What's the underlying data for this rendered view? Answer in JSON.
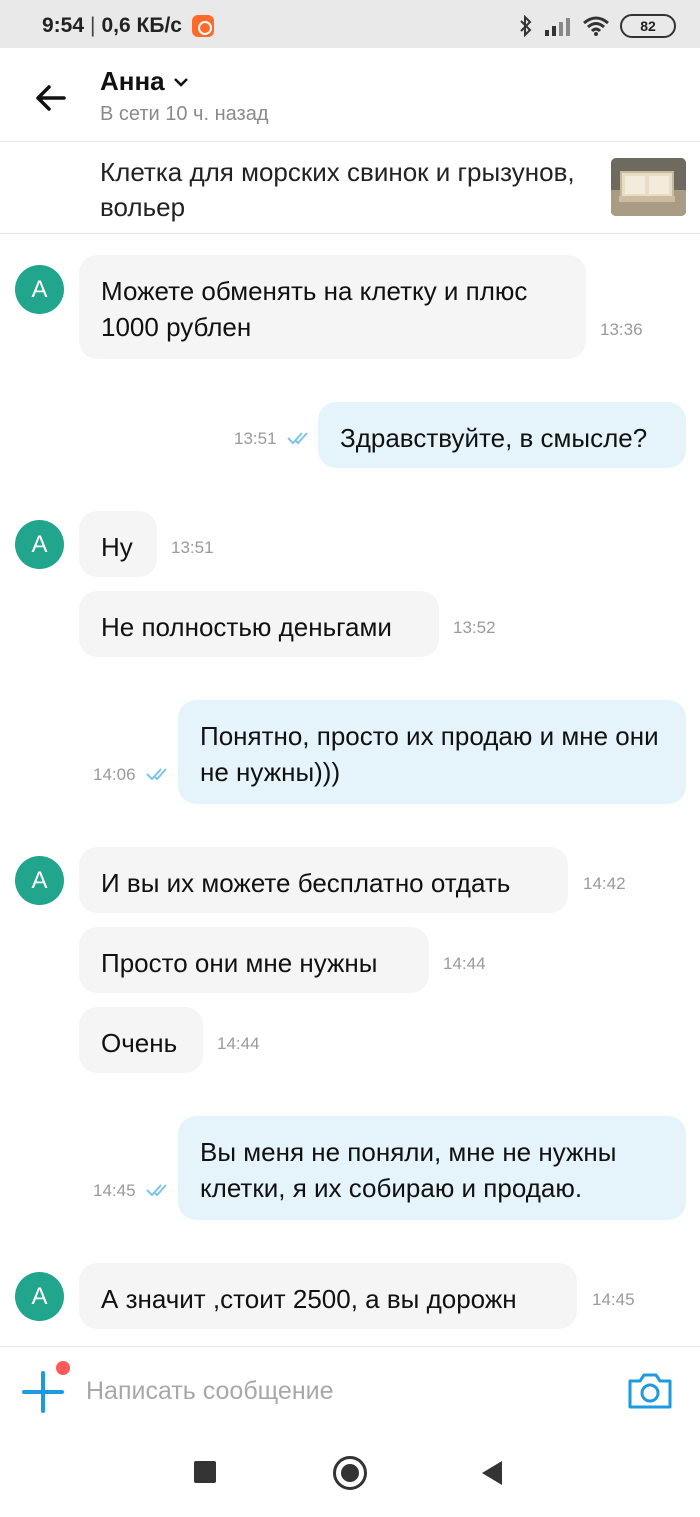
{
  "status_bar": {
    "time": "9:54",
    "speed": "0,6 КБ/с",
    "battery": "82"
  },
  "header": {
    "contact_name": "Анна",
    "status": "В сети 10 ч. назад"
  },
  "listing": {
    "title": "Клетка для морских свинок и грызунов, вольер"
  },
  "messages": [
    {
      "dir": "in",
      "avatar": "А",
      "text": "Можете обменять на клетку и плюс 1000 рублен",
      "time": "13:36"
    },
    {
      "dir": "out",
      "text": "Здравствуйте, в смысле?",
      "time": "13:51"
    },
    {
      "dir": "in",
      "avatar": "А",
      "text": "Ну",
      "time": "13:51"
    },
    {
      "dir": "in",
      "text": "Не полностью деньгами",
      "time": "13:52"
    },
    {
      "dir": "out",
      "text": "Понятно, просто их продаю и мне они не нужны)))",
      "time": "14:06"
    },
    {
      "dir": "in",
      "avatar": "А",
      "text": "И вы их можете бесплатно отдать",
      "time": "14:42"
    },
    {
      "dir": "in",
      "text": "Просто они мне нужны",
      "time": "14:44"
    },
    {
      "dir": "in",
      "text": "Очень",
      "time": "14:44"
    },
    {
      "dir": "out",
      "text": "Вы меня не поняли, мне не нужны клетки, я их собираю и продаю.",
      "time": "14:45"
    },
    {
      "dir": "in",
      "avatar": "А",
      "text": "А значит ,стоит 2500, а вы дорожн",
      "time": "14:45"
    }
  ],
  "composer": {
    "placeholder": "Написать сообщение"
  },
  "colors": {
    "accent": "#1e9be0",
    "avatar": "#21a58c",
    "incoming_bubble": "#f5f5f5",
    "outgoing_bubble": "#e5f4fb",
    "notification_dot": "#ff5a5a"
  },
  "icons": {
    "back": "arrow-left-icon",
    "dropdown": "chevron-down-icon",
    "read_receipt": "double-check-icon",
    "attach": "plus-icon",
    "camera": "camera-icon"
  }
}
